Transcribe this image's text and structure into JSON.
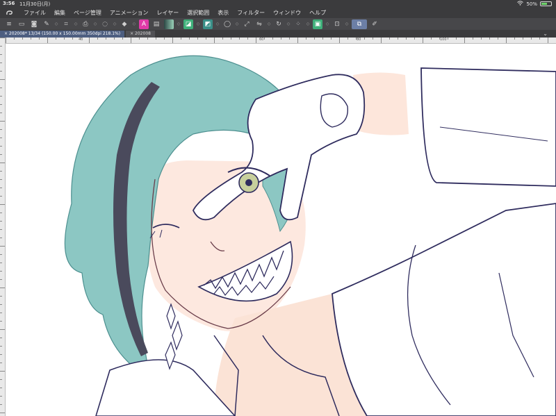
{
  "status": {
    "time": "3:56",
    "date": "11月30日(月)",
    "battery": "50%"
  },
  "menu": [
    "ファイル",
    "編集",
    "ページ管理",
    "アニメーション",
    "レイヤー",
    "選択範囲",
    "表示",
    "フィルター",
    "ウィンドウ",
    "ヘルプ"
  ],
  "tabs": [
    {
      "label": "× 202008* 13/34 (150.00 x 150.00mm 350dpi 218.1%)",
      "active": true
    },
    {
      "label": "× 202008",
      "active": false
    }
  ],
  "ruler": {
    "labels": [
      "40",
      "60",
      "80",
      "100"
    ]
  },
  "colors": {
    "accent": "#6c7fa6",
    "hair": "#7fc1bf",
    "skin": "#fbe6dc",
    "line": "#2f2c5e"
  }
}
